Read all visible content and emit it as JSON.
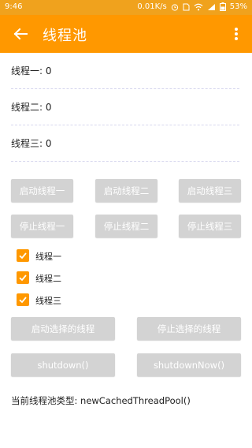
{
  "status_bar": {
    "time": "9:46",
    "net_speed": "0.01K/s",
    "battery": "53%"
  },
  "toolbar": {
    "title": "线程池",
    "back_icon": "arrow-left-icon",
    "menu_icon": "more-vertical-icon",
    "background": "#ff9800"
  },
  "threads": [
    {
      "label": "线程一: 0"
    },
    {
      "label": "线程二: 0"
    },
    {
      "label": "线程三: 0"
    }
  ],
  "buttons": {
    "start1": "启动线程一",
    "start2": "启动线程二",
    "start3": "启动线程三",
    "stop1": "停止线程一",
    "stop2": "停止线程二",
    "stop3": "停止线程三",
    "start_selected": "启动选择的线程",
    "stop_selected": "停止选择的线程",
    "shutdown": "shutdown()",
    "shutdown_now": "shutdownNow()"
  },
  "checkboxes": [
    {
      "label": "线程一",
      "checked": true
    },
    {
      "label": "线程二",
      "checked": true
    },
    {
      "label": "线程三",
      "checked": true
    }
  ],
  "pool_type": "当前线程池类型: newCachedThreadPool()"
}
